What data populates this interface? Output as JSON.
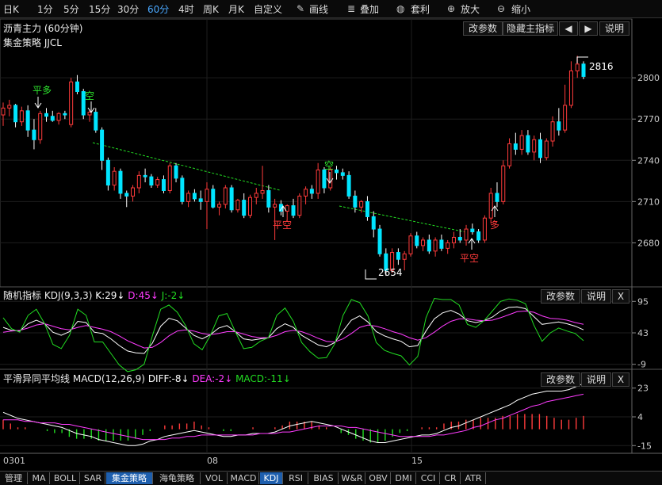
{
  "toolbar": {
    "items": [
      "日K",
      "1分",
      "5分",
      "15分",
      "30分",
      "60分",
      "4时",
      "周K",
      "月K",
      "自定义"
    ],
    "active": "60分",
    "tools": [
      {
        "label": "画线",
        "icon": "pencil-icon"
      },
      {
        "label": "叠加",
        "icon": "stack-icon"
      },
      {
        "label": "套利",
        "icon": "moneybag-icon"
      },
      {
        "label": "放大",
        "icon": "zoom-in-icon"
      },
      {
        "label": "缩小",
        "icon": "zoom-out-icon"
      }
    ]
  },
  "main": {
    "title": "沥青主力 (60分钟)",
    "subtitle": "集金策略 JJCL",
    "buttons": [
      "改参数",
      "隐藏主指标",
      "◀",
      "▶",
      "说明"
    ],
    "annotations": {
      "pingduo": "平多",
      "kong1": "空",
      "kong2": "空",
      "pingkong1": "平空",
      "pingkong2": "平空",
      "duo": "多",
      "high_label": "2816",
      "low_label": "2654"
    }
  },
  "kdj_panel": {
    "name": "随机指标",
    "params": "KDJ(9,3,3)",
    "k": "K:29↓",
    "d": "D:45↓",
    "j": "J:-2↓",
    "buttons": [
      "改参数",
      "说明",
      "X"
    ]
  },
  "macd_panel": {
    "name": "平滑异同平均线",
    "params": "MACD(12,26,9)",
    "diff": "DIFF:-8↓",
    "dea": "DEA:-2↓",
    "macd": "MACD:-11↓",
    "buttons": [
      "改参数",
      "说明",
      "X"
    ]
  },
  "x_labels": [
    "0301",
    "08",
    "15"
  ],
  "tabs": [
    "管理",
    "MA",
    "BOLL",
    "SAR",
    "集金策略",
    "海龟策略",
    "VOL",
    "MACD",
    "KDJ",
    "RSI",
    "BIAS",
    "W&R",
    "OBV",
    "DMI",
    "CCI",
    "CR",
    "ATR"
  ],
  "selected_tabs": [
    "集金策略",
    "KDJ"
  ],
  "colors": {
    "up": "#ff3b3b",
    "down": "#00e5ff",
    "signal_green": "#2ee62e",
    "signal_red": "#ff3b3b",
    "k_line": "#ffffff",
    "d_line": "#ff3cff",
    "j_line": "#22dd22",
    "trend": "#22dd22"
  },
  "chart_data": [
    {
      "type": "candlestick",
      "title": "沥青主力 (60分钟)",
      "ylim": [
        2652,
        2822
      ],
      "yticks": [
        2680,
        2710,
        2740,
        2770,
        2800
      ],
      "ohlc": [
        [
          2773,
          2782,
          2765,
          2778
        ],
        [
          2778,
          2784,
          2772,
          2780
        ],
        [
          2780,
          2781,
          2764,
          2768
        ],
        [
          2768,
          2779,
          2765,
          2776
        ],
        [
          2776,
          2780,
          2757,
          2762
        ],
        [
          2762,
          2770,
          2748,
          2755
        ],
        [
          2755,
          2776,
          2752,
          2774
        ],
        [
          2774,
          2778,
          2768,
          2772
        ],
        [
          2772,
          2776,
          2768,
          2769
        ],
        [
          2769,
          2775,
          2766,
          2774
        ],
        [
          2774,
          2776,
          2770,
          2773
        ],
        [
          2766,
          2800,
          2764,
          2797
        ],
        [
          2797,
          2802,
          2788,
          2790
        ],
        [
          2790,
          2792,
          2770,
          2773
        ],
        [
          2773,
          2777,
          2768,
          2775
        ],
        [
          2775,
          2778,
          2760,
          2762
        ],
        [
          2762,
          2764,
          2733,
          2740
        ],
        [
          2740,
          2742,
          2718,
          2722
        ],
        [
          2722,
          2735,
          2718,
          2732
        ],
        [
          2732,
          2734,
          2712,
          2716
        ],
        [
          2716,
          2718,
          2706,
          2714
        ],
        [
          2714,
          2722,
          2710,
          2720
        ],
        [
          2720,
          2732,
          2716,
          2729
        ],
        [
          2729,
          2734,
          2724,
          2728
        ],
        [
          2728,
          2730,
          2720,
          2722
        ],
        [
          2722,
          2728,
          2720,
          2726
        ],
        [
          2726,
          2729,
          2716,
          2718
        ],
        [
          2718,
          2738,
          2716,
          2736
        ],
        [
          2736,
          2738,
          2724,
          2727
        ],
        [
          2727,
          2729,
          2708,
          2710
        ],
        [
          2710,
          2718,
          2706,
          2716
        ],
        [
          2716,
          2719,
          2710,
          2712
        ],
        [
          2712,
          2718,
          2704,
          2710
        ],
        [
          2710,
          2724,
          2690,
          2719
        ],
        [
          2719,
          2722,
          2705,
          2706
        ],
        [
          2706,
          2710,
          2700,
          2708
        ],
        [
          2708,
          2722,
          2705,
          2720
        ],
        [
          2720,
          2722,
          2702,
          2704
        ],
        [
          2704,
          2712,
          2702,
          2711
        ],
        [
          2711,
          2716,
          2698,
          2700
        ],
        [
          2700,
          2715,
          2698,
          2713
        ],
        [
          2713,
          2720,
          2708,
          2716
        ],
        [
          2716,
          2736,
          2712,
          2718
        ],
        [
          2718,
          2722,
          2702,
          2706
        ],
        [
          2706,
          2712,
          2682,
          2708
        ],
        [
          2708,
          2711,
          2700,
          2703
        ],
        [
          2703,
          2708,
          2696,
          2707
        ],
        [
          2707,
          2712,
          2698,
          2700
        ],
        [
          2700,
          2716,
          2698,
          2714
        ],
        [
          2714,
          2721,
          2708,
          2719
        ],
        [
          2719,
          2722,
          2712,
          2716
        ],
        [
          2716,
          2738,
          2712,
          2733
        ],
        [
          2733,
          2735,
          2716,
          2720
        ],
        [
          2720,
          2735,
          2718,
          2733
        ],
        [
          2733,
          2736,
          2726,
          2731
        ],
        [
          2731,
          2734,
          2726,
          2729
        ],
        [
          2729,
          2732,
          2712,
          2714
        ],
        [
          2714,
          2718,
          2702,
          2706
        ],
        [
          2706,
          2711,
          2702,
          2710
        ],
        [
          2710,
          2714,
          2696,
          2699
        ],
        [
          2699,
          2703,
          2684,
          2690
        ],
        [
          2690,
          2693,
          2670,
          2672
        ],
        [
          2672,
          2676,
          2656,
          2660
        ],
        [
          2660,
          2676,
          2658,
          2673
        ],
        [
          2673,
          2676,
          2664,
          2668
        ],
        [
          2668,
          2674,
          2660,
          2672
        ],
        [
          2672,
          2687,
          2670,
          2685
        ],
        [
          2685,
          2688,
          2676,
          2678
        ],
        [
          2678,
          2684,
          2674,
          2682
        ],
        [
          2682,
          2686,
          2672,
          2674
        ],
        [
          2674,
          2684,
          2670,
          2682
        ],
        [
          2682,
          2686,
          2674,
          2676
        ],
        [
          2676,
          2682,
          2672,
          2680
        ],
        [
          2680,
          2688,
          2676,
          2684
        ],
        [
          2684,
          2690,
          2680,
          2682
        ],
        [
          2682,
          2693,
          2678,
          2690
        ],
        [
          2690,
          2694,
          2686,
          2688
        ],
        [
          2688,
          2690,
          2680,
          2682
        ],
        [
          2682,
          2700,
          2680,
          2698
        ],
        [
          2698,
          2720,
          2694,
          2716
        ],
        [
          2716,
          2724,
          2706,
          2710
        ],
        [
          2710,
          2740,
          2708,
          2736
        ],
        [
          2736,
          2756,
          2734,
          2752
        ],
        [
          2752,
          2760,
          2744,
          2748
        ],
        [
          2748,
          2762,
          2744,
          2758
        ],
        [
          2758,
          2762,
          2744,
          2746
        ],
        [
          2746,
          2758,
          2740,
          2755
        ],
        [
          2755,
          2760,
          2738,
          2742
        ],
        [
          2742,
          2756,
          2740,
          2754
        ],
        [
          2754,
          2772,
          2750,
          2768
        ],
        [
          2768,
          2778,
          2758,
          2762
        ],
        [
          2762,
          2795,
          2760,
          2780
        ],
        [
          2780,
          2812,
          2778,
          2805
        ],
        [
          2805,
          2816,
          2800,
          2810
        ],
        [
          2810,
          2812,
          2799,
          2801
        ]
      ]
    },
    {
      "type": "line",
      "title": "随机指标 KDJ(9,3,3)",
      "ylim": [
        -12,
        98
      ],
      "yticks": [
        95,
        43,
        -9
      ],
      "series": [
        {
          "name": "K",
          "values": [
            52,
            47,
            46,
            58,
            64,
            58,
            44,
            39,
            45,
            62,
            60,
            44,
            42,
            33,
            22,
            13,
            10,
            9,
            26,
            54,
            67,
            63,
            51,
            39,
            33,
            40,
            51,
            55,
            45,
            33,
            31,
            33,
            35,
            50,
            58,
            52,
            39,
            31,
            23,
            20,
            27,
            46,
            64,
            71,
            61,
            45,
            38,
            33,
            29,
            20,
            22,
            46,
            66,
            76,
            80,
            74,
            63,
            60,
            63,
            69,
            79,
            85,
            86,
            83,
            70,
            57,
            59,
            61,
            58,
            54,
            48
          ]
        },
        {
          "name": "D",
          "values": [
            44,
            46,
            47,
            51,
            56,
            58,
            54,
            50,
            48,
            52,
            55,
            52,
            49,
            45,
            38,
            30,
            24,
            18,
            19,
            27,
            38,
            46,
            48,
            46,
            42,
            40,
            42,
            45,
            45,
            41,
            37,
            35,
            35,
            39,
            45,
            47,
            45,
            40,
            34,
            29,
            28,
            33,
            42,
            52,
            56,
            54,
            50,
            45,
            41,
            35,
            31,
            35,
            44,
            54,
            62,
            66,
            66,
            64,
            63,
            64,
            68,
            73,
            78,
            79,
            77,
            71,
            67,
            66,
            64,
            60,
            57
          ]
        },
        {
          "name": "J",
          "values": [
            68,
            50,
            44,
            72,
            82,
            58,
            24,
            17,
            39,
            82,
            72,
            28,
            28,
            9,
            -10,
            -21,
            -18,
            -9,
            38,
            82,
            89,
            77,
            55,
            25,
            15,
            39,
            71,
            75,
            45,
            17,
            19,
            29,
            35,
            72,
            84,
            62,
            27,
            12,
            1,
            2,
            25,
            72,
            98,
            93,
            71,
            27,
            14,
            9,
            5,
            -10,
            4,
            68,
            100,
            98,
            98,
            89,
            57,
            52,
            63,
            79,
            95,
            99,
            97,
            91,
            56,
            29,
            43,
            51,
            46,
            42,
            30
          ]
        }
      ]
    },
    {
      "type": "bar",
      "title": "平滑异同平均线 MACD(12,26,9)",
      "ylim": [
        -18,
        26
      ],
      "yticks": [
        23,
        4,
        -15
      ],
      "series": [
        {
          "name": "DIFF",
          "values": [
            7,
            5,
            3,
            2,
            1,
            0,
            -1,
            -2,
            -3,
            -5,
            -7,
            -8,
            -9,
            -11,
            -12,
            -13,
            -14,
            -15,
            -15,
            -14,
            -12,
            -11,
            -9,
            -8,
            -7,
            -6,
            -5,
            -6,
            -7,
            -8,
            -9,
            -9,
            -8,
            -8,
            -7,
            -7,
            -7,
            -6,
            -4,
            -2,
            -1,
            0,
            1,
            0,
            -1,
            -2,
            -4,
            -6,
            -8,
            -10,
            -12,
            -13,
            -13,
            -12,
            -11,
            -10,
            -9,
            -8,
            -8,
            -7,
            -5,
            -3,
            -2,
            0,
            2,
            4,
            6,
            8,
            10,
            12,
            15,
            17,
            19,
            20,
            21,
            21,
            21,
            22,
            24,
            26
          ]
        },
        {
          "name": "DEA",
          "values": [
            2,
            2,
            2,
            1,
            1,
            0,
            0,
            0,
            -1,
            -1,
            -2,
            -3,
            -4,
            -5,
            -6,
            -7,
            -8,
            -9,
            -10,
            -11,
            -11,
            -11,
            -11,
            -10,
            -10,
            -9,
            -9,
            -8,
            -8,
            -8,
            -8,
            -8,
            -8,
            -8,
            -8,
            -7,
            -7,
            -7,
            -6,
            -6,
            -5,
            -4,
            -3,
            -2,
            -2,
            -2,
            -2,
            -3,
            -3,
            -4,
            -5,
            -6,
            -7,
            -8,
            -9,
            -9,
            -9,
            -9,
            -9,
            -8,
            -8,
            -7,
            -6,
            -5,
            -3,
            -2,
            0,
            2,
            3,
            5,
            7,
            9,
            11,
            12,
            14,
            15,
            16,
            17,
            18,
            19
          ]
        },
        {
          "name": "MACD",
          "values": [
            10,
            6,
            2,
            2,
            0,
            0,
            -2,
            -4,
            -4,
            -8,
            -10,
            -10,
            -10,
            -12,
            -12,
            -12,
            -12,
            -12,
            -10,
            -6,
            -2,
            0,
            4,
            4,
            6,
            6,
            8,
            4,
            2,
            0,
            -2,
            -2,
            0,
            0,
            2,
            0,
            0,
            2,
            4,
            8,
            8,
            8,
            8,
            4,
            2,
            0,
            -4,
            -6,
            -10,
            -12,
            -14,
            -14,
            -12,
            -8,
            -4,
            -2,
            0,
            2,
            2,
            2,
            6,
            8,
            8,
            10,
            10,
            12,
            12,
            12,
            14,
            14,
            16,
            16,
            16,
            16,
            14,
            12,
            10,
            10,
            12,
            14
          ]
        }
      ]
    }
  ]
}
